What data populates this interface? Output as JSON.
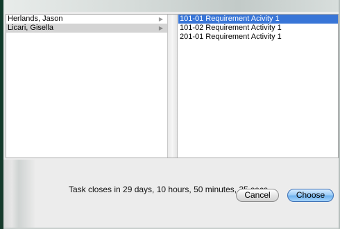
{
  "people": [
    {
      "name": "Herlands, Jason",
      "selected": false
    },
    {
      "name": "Licari, Gisella",
      "selected": true
    }
  ],
  "activities": [
    {
      "label": "101-01 Requirement Acivity 1",
      "selected": true
    },
    {
      "label": "101-02 Requirement Activity 1",
      "selected": false
    },
    {
      "label": "201-01 Requirement Activity 1",
      "selected": false
    }
  ],
  "status": {
    "text": "Task closes in 29 days, 10 hours, 50 minutes, 35 secs."
  },
  "buttons": {
    "cancel_label": "Cancel",
    "choose_label": "Choose"
  },
  "icons": {
    "expand": "disclosure-arrow-icon"
  },
  "colors": {
    "selection_blue": "#3875d7",
    "selection_gray": "#d4d4d4",
    "default_button": "#6fb2ee"
  }
}
